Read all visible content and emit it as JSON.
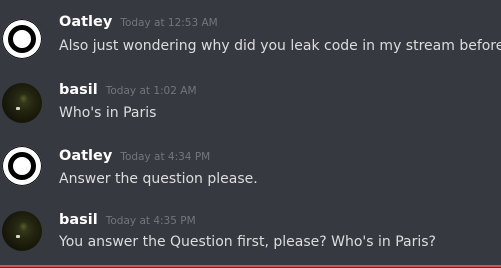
{
  "messages": [
    {
      "author": "Oatley",
      "timestamp": "Today at 12:53 AM",
      "text": "Also just wondering why did you leak code in my stream before?"
    },
    {
      "author": "basil",
      "timestamp": "Today at 1:02 AM",
      "text": "Who's in Paris"
    },
    {
      "author": "Oatley",
      "timestamp": "Today at 4:34 PM",
      "text": "Answer the question please."
    },
    {
      "author": "basil",
      "timestamp": "Today at 4:35 PM",
      "text": "You answer the Question first, please? Who's in Paris?"
    }
  ],
  "colors": {
    "background": "#36393f",
    "name": "#ffffff",
    "timestamp": "#72767d",
    "text": "#dcddde",
    "divider": "#f04747"
  }
}
